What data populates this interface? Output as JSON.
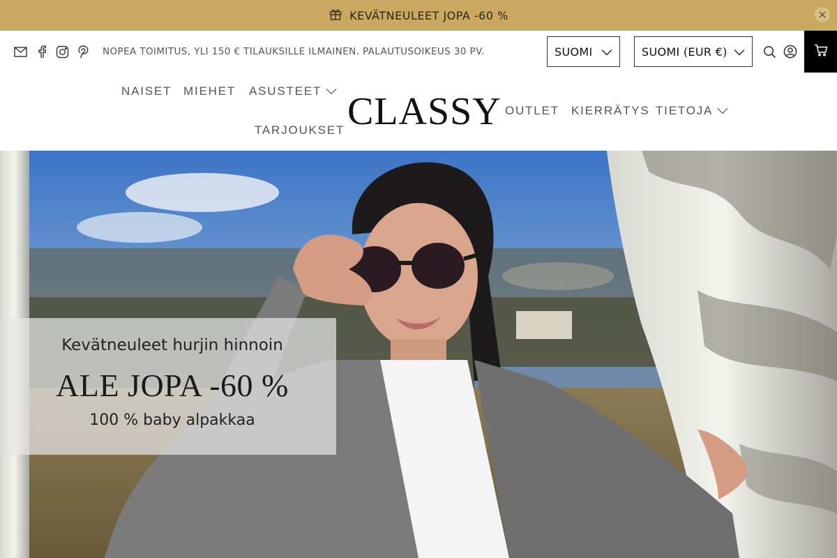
{
  "announcement": {
    "text": "KEVÄTNEULEET JOPA -60 %",
    "icon": "gift-icon",
    "close_icon": "close-icon"
  },
  "utility": {
    "social_icons": [
      "mail-icon",
      "facebook-icon",
      "instagram-icon",
      "pinterest-icon"
    ],
    "shipping_text": "NOPEA TOIMITUS, YLI 150 € TILAUKSILLE ILMAINEN. PALAUTUSOIKEUS 30 PV.",
    "language": "SUOMI",
    "currency": "SUOMI (EUR €)"
  },
  "nav": {
    "left": [
      "NAISET",
      "MIEHET",
      "ASUSTEET",
      "TARJOUKSET"
    ],
    "logo": "CLASSY",
    "right": [
      "OUTLET",
      "KIERRÄTYS",
      "TIETOJA"
    ]
  },
  "hero": {
    "subtitle": "Kevätneuleet hurjin hinnoin",
    "headline": "ALE JOPA -60 %",
    "footnote": "100 % baby alpakkaa"
  },
  "colors": {
    "announcement_bg": "#c9a95f",
    "cart_bg": "#000000",
    "text_dark": "#111111"
  }
}
